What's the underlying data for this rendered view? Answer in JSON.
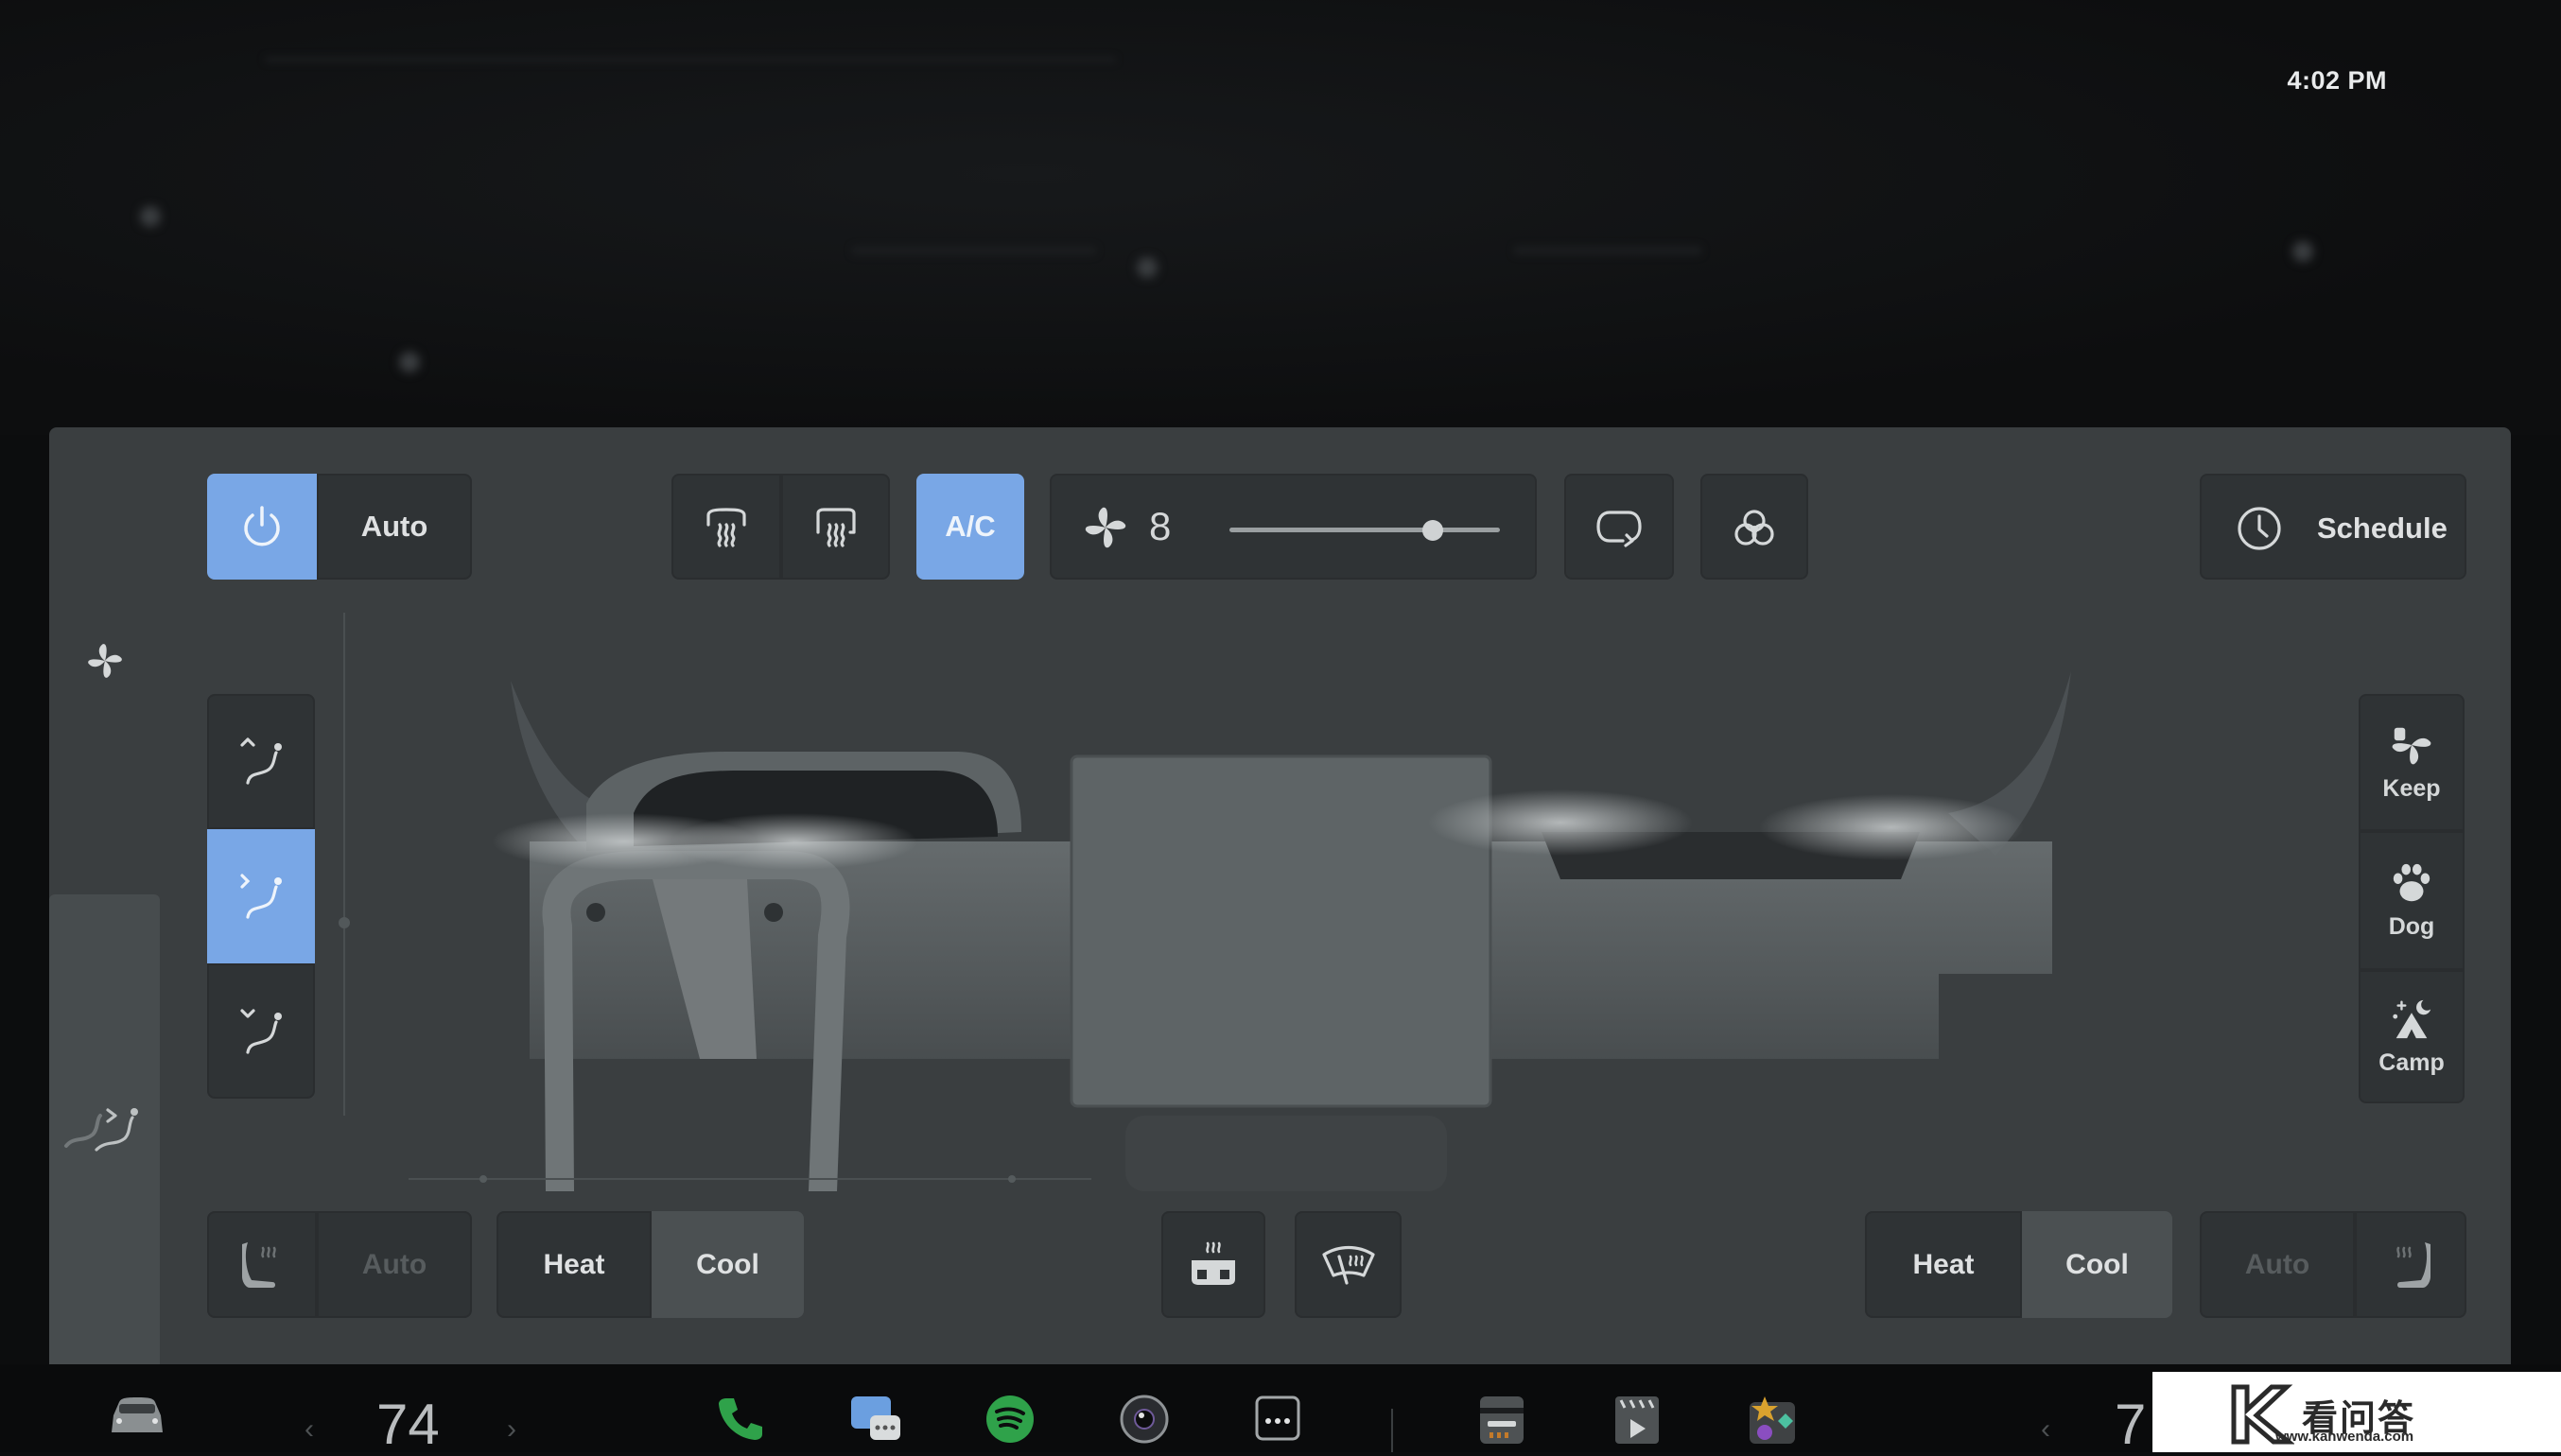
{
  "status_bar": {
    "time": "4:02 PM"
  },
  "top_controls": {
    "power": {
      "icon": "power-icon",
      "active": true
    },
    "auto_label": "Auto",
    "front_defrost": {
      "icon": "front-defrost-icon"
    },
    "rear_defrost": {
      "icon": "rear-defrost-icon"
    },
    "ac_label": "A/C",
    "ac_active": true,
    "fan": {
      "icon": "fan-icon",
      "speed": "8",
      "slider_fraction": 0.75
    },
    "recirculate": {
      "icon": "recirculate-icon"
    },
    "bioweapon_defense": {
      "icon": "biohazard-icon"
    },
    "schedule": {
      "icon": "clock-icon",
      "label": "Schedule"
    }
  },
  "left_sidebar": {
    "fan_icon": "fan-icon",
    "vent_modes": [
      {
        "name": "face-vent-up",
        "icon": "vent-up-icon",
        "active": false
      },
      {
        "name": "face-vent-straight",
        "icon": "vent-straight-icon",
        "active": true
      },
      {
        "name": "face-vent-down",
        "icon": "vent-down-icon",
        "active": false
      }
    ],
    "rear_vent_icon": "rear-vent-icon"
  },
  "right_modes": [
    {
      "label": "Keep",
      "icon": "keep-climate-icon"
    },
    {
      "label": "Dog",
      "icon": "paw-icon"
    },
    {
      "label": "Camp",
      "icon": "camp-tent-icon"
    }
  ],
  "bottom_controls": {
    "driver_seat": {
      "icon": "seat-heat-icon",
      "auto_label": "Auto",
      "heat_label": "Heat",
      "cool_label": "Cool",
      "selected": "Cool"
    },
    "steering_heat": {
      "icon": "steering-wheel-heat-icon"
    },
    "wiper_defrost": {
      "icon": "wiper-defrost-icon"
    },
    "passenger_seat": {
      "icon": "seat-heat-icon",
      "auto_label": "Auto",
      "heat_label": "Heat",
      "cool_label": "Cool",
      "selected": "Cool"
    }
  },
  "taskbar": {
    "car_icon": "car-icon",
    "driver_temp": "74",
    "passenger_temp": "7",
    "apps": [
      {
        "name": "phone",
        "icon": "phone-icon",
        "color": "#2fa24a"
      },
      {
        "name": "messages",
        "icon": "messages-icon",
        "color": "#6b9fe0"
      },
      {
        "name": "spotify",
        "icon": "spotify-icon",
        "color": "#2fa24a"
      },
      {
        "name": "camera",
        "icon": "camera-icon"
      },
      {
        "name": "more",
        "icon": "more-icon"
      },
      {
        "name": "dashcam",
        "icon": "dashcam-icon"
      },
      {
        "name": "theater",
        "icon": "theater-icon"
      },
      {
        "name": "toybox",
        "icon": "toybox-icon"
      }
    ]
  },
  "watermark": {
    "title": "看问答",
    "url": "www.kanwenda.com"
  },
  "colors": {
    "accent": "#79a7e6",
    "panel": "#3a3e40",
    "button": "#2f3335",
    "selected": "#4b5052"
  }
}
